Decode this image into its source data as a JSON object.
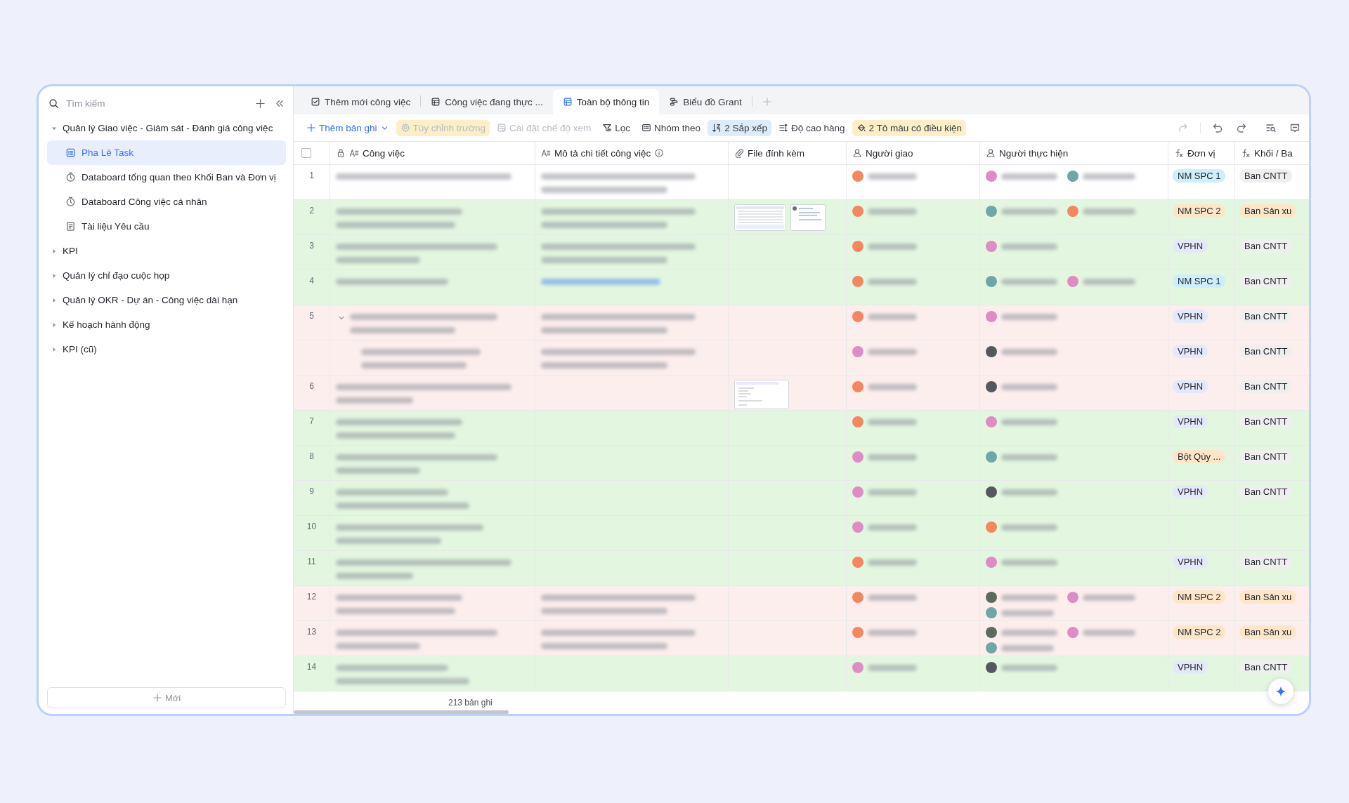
{
  "sidebar": {
    "search": {
      "placeholder": "Tìm kiếm"
    },
    "tree": [
      {
        "label": "Quản lý Giao việc - Giám sát - Đánh giá công việc",
        "expanded": true,
        "selected": false,
        "children": [
          {
            "label": "Pha Lê Task",
            "kind": "table",
            "selected": true
          },
          {
            "label": "Databoard tổng quan theo Khối Ban và Đơn vị",
            "kind": "dashboard",
            "selected": false
          },
          {
            "label": "Databoard Công việc cá nhân",
            "kind": "dashboard",
            "selected": false
          },
          {
            "label": "Tài liệu Yêu cầu",
            "kind": "document",
            "selected": false
          }
        ]
      },
      {
        "label": "KPI",
        "expanded": false,
        "selected": false
      },
      {
        "label": "Quản lý chỉ đạo cuộc họp",
        "expanded": false,
        "selected": false
      },
      {
        "label": "Quản lý OKR - Dự án - Công việc dài hạn",
        "expanded": false,
        "selected": false
      },
      {
        "label": "Kế hoạch hành động",
        "expanded": false,
        "selected": false
      },
      {
        "label": "KPI (cũ)",
        "expanded": false,
        "selected": false
      }
    ],
    "new_button": "Mới"
  },
  "tabs": [
    {
      "label": "Thêm mới công việc",
      "kind": "form",
      "selected": false
    },
    {
      "label": "Công việc đang thực ...",
      "kind": "grid",
      "selected": false
    },
    {
      "label": "Toàn bộ thông tin",
      "kind": "grid",
      "selected": true
    },
    {
      "label": "Biểu đồ Grant",
      "kind": "gantt",
      "selected": false
    }
  ],
  "toolbar": {
    "items": [
      {
        "label": "Thêm bản ghi",
        "kind": "add",
        "disabled": false,
        "active": false
      },
      {
        "label": "Tùy chỉnh trường",
        "kind": "fields",
        "disabled": true,
        "active": true
      },
      {
        "label": "Cài đặt chế độ xem",
        "kind": "view",
        "disabled": true,
        "active": false
      },
      {
        "label": "Lọc",
        "kind": "filter",
        "disabled": false,
        "active": false
      },
      {
        "label": "Nhóm theo",
        "kind": "group",
        "disabled": false,
        "active": false
      },
      {
        "label": "2 Sắp xếp",
        "kind": "sort",
        "disabled": false,
        "active": true
      },
      {
        "label": "Độ cao hàng",
        "kind": "height",
        "disabled": false,
        "active": false
      },
      {
        "label": "2 Tô màu có điều kiện",
        "kind": "paint",
        "disabled": false,
        "active": true
      }
    ]
  },
  "table": {
    "select_all": {
      "checked": false
    },
    "columns": [
      {
        "label": "Công việc",
        "kind": "text",
        "locked": true,
        "info": false
      },
      {
        "label": "Mô tả chi tiết công việc",
        "kind": "text",
        "locked": false,
        "info": true
      },
      {
        "label": "File đính kèm",
        "kind": "attachment",
        "locked": false,
        "info": false
      },
      {
        "label": "Người giao",
        "kind": "person",
        "locked": false,
        "info": false
      },
      {
        "label": "Người thực hiện",
        "kind": "person",
        "locked": false,
        "info": false
      },
      {
        "label": "Đơn vị",
        "kind": "formula",
        "locked": false,
        "info": false
      },
      {
        "label": "Khối / Ba",
        "kind": "formula",
        "locked": false,
        "info": false
      }
    ],
    "rows": [
      {
        "number": "1",
        "color": "#ffffff",
        "kind": "described",
        "assigner": {
          "color": "#f4875f"
        },
        "assignees": [
          {
            "color": "#e08cc4"
          },
          {
            "color": "#6fa7a6"
          }
        ],
        "unit": {
          "label": "NM SPC 1",
          "color": "#cdeefb"
        },
        "block": {
          "label": "Ban CNTT",
          "color": "#efefef"
        }
      },
      {
        "number": "2",
        "color": "#e3f7e0",
        "kind": "described",
        "attachments": [
          {
            "kind": "spreadsheet"
          },
          {
            "kind": "chat"
          }
        ],
        "assigner": {
          "color": "#f4875f"
        },
        "assignees": [
          {
            "color": "#6fa7a6"
          },
          {
            "color": "#f4875f"
          }
        ],
        "unit": {
          "label": "NM SPC 2",
          "color": "#fde5c8"
        },
        "block": {
          "label": "Ban Sản xu",
          "color": "#fde5c8"
        }
      },
      {
        "number": "3",
        "color": "#e3f7e0",
        "kind": "described",
        "assigner": {
          "color": "#f4875f"
        },
        "assignees": [
          {
            "color": "#e08cc4"
          }
        ],
        "unit": {
          "label": "VPHN",
          "color": "#e4e8fb"
        },
        "block": {
          "label": "Ban CNTT",
          "color": "#efefef"
        }
      },
      {
        "number": "4",
        "color": "#e3f7e0",
        "kind": "linked",
        "assigner": {
          "color": "#f4875f"
        },
        "assignees": [
          {
            "color": "#6fa7a6"
          },
          {
            "color": "#e08cc4"
          }
        ],
        "unit": {
          "label": "NM SPC 1",
          "color": "#cdeefb"
        },
        "block": {
          "label": "Ban CNTT",
          "color": "#efefef"
        }
      },
      {
        "number": "5",
        "color": "#fdeeee",
        "kind": "described",
        "assigner": {
          "color": "#f4875f"
        },
        "assignees": [
          {
            "color": "#e08cc4"
          }
        ],
        "unit": {
          "label": "VPHN",
          "color": "#e4e8fb"
        },
        "block": {
          "label": "Ban CNTT",
          "color": "#efefef"
        },
        "expanded": true,
        "children": [
          {
            "color": "#fdeeee",
            "kind": "described",
            "assigner": {
              "color": "#e08cc4"
            },
            "assignees": [
              {
                "color": "#55595f"
              }
            ],
            "unit": {
              "label": "VPHN",
              "color": "#e4e8fb"
            },
            "block": {
              "label": "Ban CNTT",
              "color": "#efefef"
            }
          }
        ]
      },
      {
        "number": "6",
        "color": "#fdeeee",
        "kind": "plain",
        "attachments": [
          {
            "kind": "document"
          }
        ],
        "assigner": {
          "color": "#f4875f"
        },
        "assignees": [
          {
            "color": "#55595f"
          }
        ],
        "unit": {
          "label": "VPHN",
          "color": "#e4e8fb"
        },
        "block": {
          "label": "Ban CNTT",
          "color": "#efefef"
        }
      },
      {
        "number": "7",
        "color": "#e3f7e0",
        "kind": "plain",
        "assigner": {
          "color": "#f4875f"
        },
        "assignees": [
          {
            "color": "#e08cc4"
          }
        ],
        "unit": {
          "label": "VPHN",
          "color": "#e4e8fb"
        },
        "block": {
          "label": "Ban CNTT",
          "color": "#efefef"
        }
      },
      {
        "number": "8",
        "color": "#e3f7e0",
        "kind": "plain",
        "assigner": {
          "color": "#e08cc4"
        },
        "assignees": [
          {
            "color": "#6fa7a6"
          }
        ],
        "unit": {
          "label": "Bột Qùy ...",
          "color": "#fde5c8"
        },
        "block": {
          "label": "Ban CNTT",
          "color": "#efefef"
        }
      },
      {
        "number": "9",
        "color": "#e3f7e0",
        "kind": "plain",
        "assigner": {
          "color": "#e08cc4"
        },
        "assignees": [
          {
            "color": "#55595f"
          }
        ],
        "unit": {
          "label": "VPHN",
          "color": "#e4e8fb"
        },
        "block": {
          "label": "Ban CNTT",
          "color": "#efefef"
        }
      },
      {
        "number": "10",
        "color": "#e3f7e0",
        "kind": "plain",
        "assigner": {
          "color": "#e08cc4"
        },
        "assignees": [
          {
            "color": "#f4875f"
          }
        ]
      },
      {
        "number": "11",
        "color": "#e3f7e0",
        "kind": "plain",
        "assigner": {
          "color": "#f4875f"
        },
        "assignees": [
          {
            "color": "#e08cc4"
          }
        ],
        "unit": {
          "label": "VPHN",
          "color": "#e4e8fb"
        },
        "block": {
          "label": "Ban CNTT",
          "color": "#efefef"
        }
      },
      {
        "number": "12",
        "color": "#fdeeee",
        "kind": "described",
        "assigner": {
          "color": "#f4875f"
        },
        "assignees": [
          {
            "color": "#5d6b5d"
          },
          {
            "color": "#e08cc4"
          },
          {
            "color": "#6fa7a6"
          }
        ],
        "unit": {
          "label": "NM SPC 2",
          "color": "#fde5c8"
        },
        "block": {
          "label": "Ban Sản xu",
          "color": "#fde5c8"
        }
      },
      {
        "number": "13",
        "color": "#fdeeee",
        "kind": "described",
        "assigner": {
          "color": "#f4875f"
        },
        "assignees": [
          {
            "color": "#5d6b5d"
          },
          {
            "color": "#e08cc4"
          },
          {
            "color": "#6fa7a6"
          }
        ],
        "unit": {
          "label": "NM SPC 2",
          "color": "#fde5c8"
        },
        "block": {
          "label": "Ban Sản xu",
          "color": "#fde5c8"
        }
      },
      {
        "number": "14",
        "color": "#e3f7e0",
        "kind": "plain",
        "assigner": {
          "color": "#e08cc4"
        },
        "assignees": [
          {
            "color": "#55595f"
          }
        ],
        "unit": {
          "label": "VPHN",
          "color": "#e4e8fb"
        },
        "block": {
          "label": "Ban CNTT",
          "color": "#efefef"
        }
      }
    ]
  },
  "status_bar": {
    "count": "213 bản ghi"
  }
}
